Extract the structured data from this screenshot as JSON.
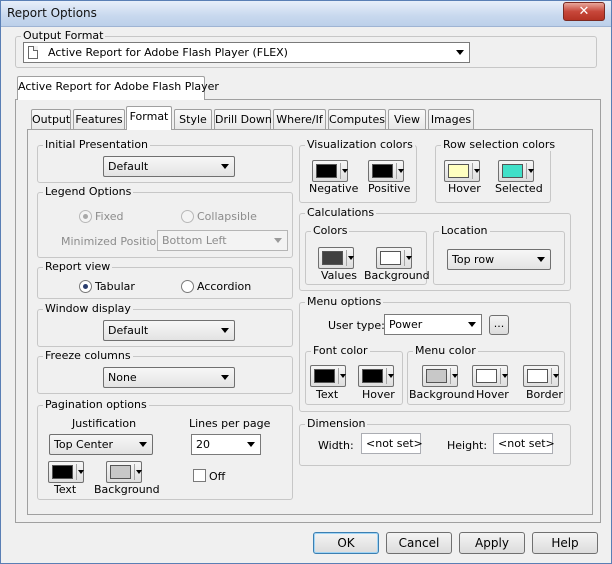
{
  "window": {
    "title": "Report Options",
    "close_label": "✕"
  },
  "output_format": {
    "label": "Output Format",
    "value": "Active Report for Adobe Flash Player (FLEX)"
  },
  "outer_tab": "Active Report for Adobe Flash Player",
  "tabs": [
    "Output",
    "Features",
    "Format",
    "Style",
    "Drill Down",
    "Where/If",
    "Computes",
    "View",
    "Images"
  ],
  "active_tab": "Format",
  "initial_presentation": {
    "label": "Initial Presentation",
    "value": "Default"
  },
  "legend_options": {
    "label": "Legend Options",
    "fixed": "Fixed",
    "collapsible": "Collapsible",
    "minimized_label": "Minimized Position:",
    "minimized_value": "Bottom Left"
  },
  "report_view": {
    "label": "Report view",
    "tabular": "Tabular",
    "accordion": "Accordion"
  },
  "window_display": {
    "label": "Window display",
    "value": "Default"
  },
  "freeze_columns": {
    "label": "Freeze columns",
    "value": "None"
  },
  "pagination": {
    "label": "Pagination options",
    "justification_label": "Justification",
    "justification_value": "Top Center",
    "lines_label": "Lines per page",
    "lines_value": "20",
    "off_label": "Off",
    "text_label": "Text",
    "background_label": "Background"
  },
  "visualization_colors": {
    "label": "Visualization colors",
    "negative": "Negative",
    "positive": "Positive"
  },
  "row_selection_colors": {
    "label": "Row selection colors",
    "hover": "Hover",
    "selected": "Selected"
  },
  "calculations": {
    "label": "Calculations",
    "colors_label": "Colors",
    "values_label": "Values",
    "background_label": "Background",
    "location_label": "Location",
    "location_value": "Top row"
  },
  "menu_options": {
    "label": "Menu options",
    "user_type_label": "User type:",
    "user_type_value": "Power",
    "browse_label": "...",
    "font_color_label": "Font color",
    "text_label": "Text",
    "hover_label": "Hover",
    "menu_color_label": "Menu color",
    "background_label": "Background",
    "hover2_label": "Hover",
    "border_label": "Border"
  },
  "dimension": {
    "label": "Dimension",
    "width_label": "Width:",
    "width_value": "<not set>",
    "height_label": "Height:",
    "height_value": "<not set>"
  },
  "buttons": {
    "ok": "OK",
    "cancel": "Cancel",
    "apply": "Apply",
    "help": "Help"
  },
  "colors": {
    "pagination_text": "#000000",
    "pagination_background": "#c8c8c8",
    "negative": "#000000",
    "positive": "#000000",
    "hover": "#ffffc0",
    "selected": "#40e0c8",
    "calc_values": "#404040",
    "calc_background": "#ffffff",
    "font_text": "#000000",
    "font_hover": "#000000",
    "menu_background": "#c8c8c8",
    "menu_hover": "#ffffff",
    "menu_border": "#ffffff"
  }
}
